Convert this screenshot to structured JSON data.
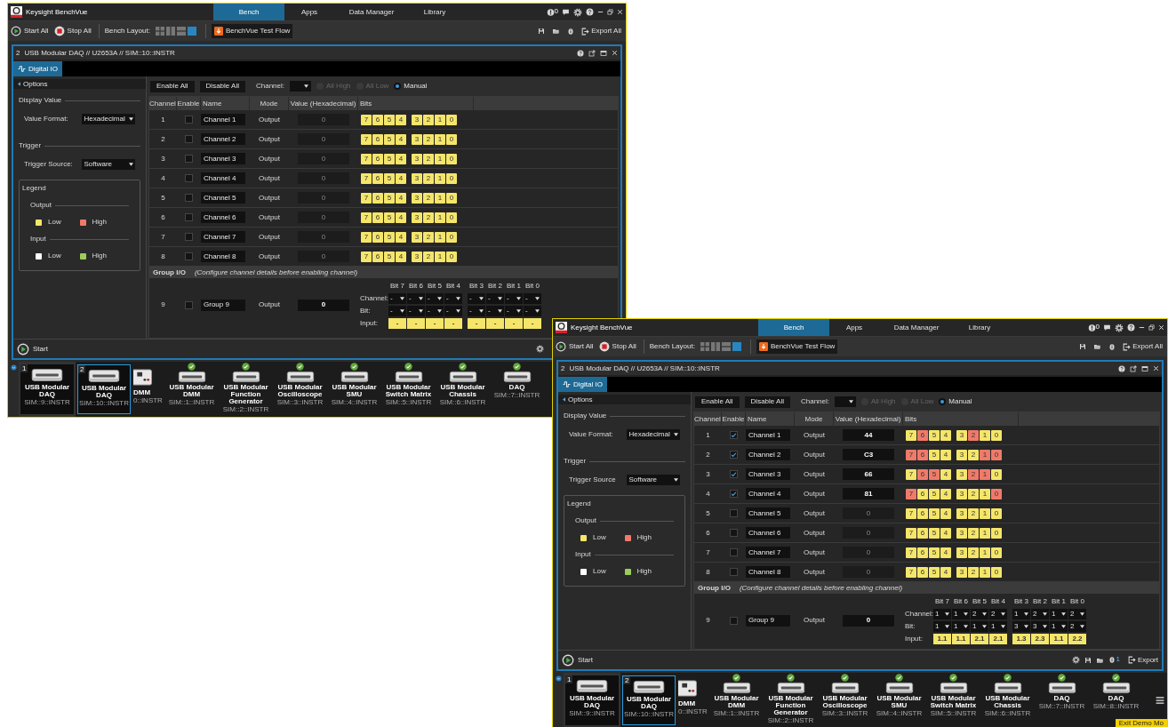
{
  "windows": [
    {
      "app_title": "Keysight BenchVue",
      "nav_tabs": [
        {
          "label": "Bench",
          "selected": true
        },
        {
          "label": "Apps",
          "selected": false
        },
        {
          "label": "Data Manager",
          "selected": false
        },
        {
          "label": "Library",
          "selected": false
        }
      ],
      "notification_count": "0",
      "toolbar": {
        "start_all": "Start All",
        "stop_all": "Stop All",
        "bench_layout_label": "Bench Layout:",
        "layouts": [
          {
            "selected": false
          },
          {
            "selected": false
          },
          {
            "selected": false
          },
          {
            "selected": true
          }
        ],
        "test_flow": "BenchVue Test Flow",
        "export_all": "Export All"
      },
      "instrument": {
        "number": "2",
        "title": "USB Modular DAQ // U2653A // SIM::10::INSTR",
        "tab": "Digital IO",
        "options": {
          "header": "Options",
          "display_value": "Display Value",
          "value_format_label": "Value Format:",
          "value_format": "Hexadecimal",
          "trigger": "Trigger",
          "trigger_source_label": "Trigger Source:",
          "trigger_source": "Software",
          "legend": {
            "title": "Legend",
            "groups": [
              {
                "title": "Output",
                "items": [
                  {
                    "label": "Low",
                    "color": "#f5e66a"
                  },
                  {
                    "label": "High",
                    "color": "#f07a6a"
                  }
                ]
              },
              {
                "title": "Input",
                "items": [
                  {
                    "label": "Low",
                    "color": "#ffffff"
                  },
                  {
                    "label": "High",
                    "color": "#9ccc5a"
                  }
                ]
              }
            ]
          }
        },
        "controls": {
          "enable_all": "Enable All",
          "disable_all": "Disable All",
          "channel_label": "Channel:",
          "modes": [
            {
              "label": "All High",
              "selected": false,
              "disabled": true
            },
            {
              "label": "All Low",
              "selected": false,
              "disabled": true
            },
            {
              "label": "Manual",
              "selected": true,
              "disabled": false
            }
          ]
        },
        "table": {
          "columns": [
            "Channel",
            "Enable",
            "Name",
            "Mode",
            "Value (Hexadecimal)",
            "Bits"
          ],
          "rows": [
            {
              "channel": "1",
              "enabled": false,
              "name": "Channel 1",
              "mode": "Output",
              "value": "0",
              "bits": [
                {
                  "label": "7",
                  "high": false
                },
                {
                  "label": "6",
                  "high": false
                },
                {
                  "label": "5",
                  "high": false
                },
                {
                  "label": "4",
                  "high": false
                },
                {
                  "label": "3",
                  "high": false
                },
                {
                  "label": "2",
                  "high": false
                },
                {
                  "label": "1",
                  "high": false
                },
                {
                  "label": "0",
                  "high": false
                }
              ]
            },
            {
              "channel": "2",
              "enabled": false,
              "name": "Channel 2",
              "mode": "Output",
              "value": "0",
              "bits": [
                {
                  "label": "7",
                  "high": false
                },
                {
                  "label": "6",
                  "high": false
                },
                {
                  "label": "5",
                  "high": false
                },
                {
                  "label": "4",
                  "high": false
                },
                {
                  "label": "3",
                  "high": false
                },
                {
                  "label": "2",
                  "high": false
                },
                {
                  "label": "1",
                  "high": false
                },
                {
                  "label": "0",
                  "high": false
                }
              ]
            },
            {
              "channel": "3",
              "enabled": false,
              "name": "Channel 3",
              "mode": "Output",
              "value": "0",
              "bits": [
                {
                  "label": "7",
                  "high": false
                },
                {
                  "label": "6",
                  "high": false
                },
                {
                  "label": "5",
                  "high": false
                },
                {
                  "label": "4",
                  "high": false
                },
                {
                  "label": "3",
                  "high": false
                },
                {
                  "label": "2",
                  "high": false
                },
                {
                  "label": "1",
                  "high": false
                },
                {
                  "label": "0",
                  "high": false
                }
              ]
            },
            {
              "channel": "4",
              "enabled": false,
              "name": "Channel 4",
              "mode": "Output",
              "value": "0",
              "bits": [
                {
                  "label": "7",
                  "high": false
                },
                {
                  "label": "6",
                  "high": false
                },
                {
                  "label": "5",
                  "high": false
                },
                {
                  "label": "4",
                  "high": false
                },
                {
                  "label": "3",
                  "high": false
                },
                {
                  "label": "2",
                  "high": false
                },
                {
                  "label": "1",
                  "high": false
                },
                {
                  "label": "0",
                  "high": false
                }
              ]
            },
            {
              "channel": "5",
              "enabled": false,
              "name": "Channel 5",
              "mode": "Output",
              "value": "0",
              "bits": [
                {
                  "label": "7",
                  "high": false
                },
                {
                  "label": "6",
                  "high": false
                },
                {
                  "label": "5",
                  "high": false
                },
                {
                  "label": "4",
                  "high": false
                },
                {
                  "label": "3",
                  "high": false
                },
                {
                  "label": "2",
                  "high": false
                },
                {
                  "label": "1",
                  "high": false
                },
                {
                  "label": "0",
                  "high": false
                }
              ]
            },
            {
              "channel": "6",
              "enabled": false,
              "name": "Channel 6",
              "mode": "Output",
              "value": "0",
              "bits": [
                {
                  "label": "7",
                  "high": false
                },
                {
                  "label": "6",
                  "high": false
                },
                {
                  "label": "5",
                  "high": false
                },
                {
                  "label": "4",
                  "high": false
                },
                {
                  "label": "3",
                  "high": false
                },
                {
                  "label": "2",
                  "high": false
                },
                {
                  "label": "1",
                  "high": false
                },
                {
                  "label": "0",
                  "high": false
                }
              ]
            },
            {
              "channel": "7",
              "enabled": false,
              "name": "Channel 7",
              "mode": "Output",
              "value": "0",
              "bits": [
                {
                  "label": "7",
                  "high": false
                },
                {
                  "label": "6",
                  "high": false
                },
                {
                  "label": "5",
                  "high": false
                },
                {
                  "label": "4",
                  "high": false
                },
                {
                  "label": "3",
                  "high": false
                },
                {
                  "label": "2",
                  "high": false
                },
                {
                  "label": "1",
                  "high": false
                },
                {
                  "label": "0",
                  "high": false
                }
              ]
            },
            {
              "channel": "8",
              "enabled": false,
              "name": "Channel 8",
              "mode": "Output",
              "value": "0",
              "bits": [
                {
                  "label": "7",
                  "high": false
                },
                {
                  "label": "6",
                  "high": false
                },
                {
                  "label": "5",
                  "high": false
                },
                {
                  "label": "4",
                  "high": false
                },
                {
                  "label": "3",
                  "high": false
                },
                {
                  "label": "2",
                  "high": false
                },
                {
                  "label": "1",
                  "high": false
                },
                {
                  "label": "0",
                  "high": false
                }
              ]
            }
          ],
          "group_header": "Group I/O",
          "group_note": "(Configure channel details before enabling channel)",
          "group": {
            "channel": "9",
            "enabled": false,
            "name": "Group 9",
            "mode": "Output",
            "value": "0",
            "bit_headers": [
              "Bit 7",
              "Bit 6",
              "Bit 5",
              "Bit 4",
              "Bit 3",
              "Bit 2",
              "Bit 1",
              "Bit 0"
            ],
            "channel_row_label": "Channel:",
            "bit_row_label": "Bit:",
            "input_row_label": "Input:",
            "channel_selects": [
              "-",
              "-",
              "-",
              "-",
              "-",
              "-",
              "-",
              "-"
            ],
            "bit_selects": [
              "-",
              "-",
              "-",
              "-",
              "-",
              "-",
              "-",
              "-"
            ],
            "inputs": [
              "-",
              "-",
              "-",
              "-",
              "-",
              "-",
              "-",
              "-"
            ]
          }
        }
      },
      "bottom_bar": {
        "start": "Start",
        "tools": [
          {
            "kind": "settings"
          }
        ]
      },
      "devices": [
        {
          "kind": "docked",
          "number": "1",
          "name": "USB Modular DAQ",
          "address": "SIM::9::INSTR",
          "selected": false
        },
        {
          "kind": "docked",
          "number": "2",
          "name": "USB Modular DAQ",
          "address": "SIM::10::INSTR",
          "selected": true
        },
        {
          "kind": "cut",
          "name": "DMM",
          "address": "0::INSTR"
        },
        {
          "kind": "available",
          "name": "USB Modular DMM",
          "address": "SIM::1::INSTR"
        },
        {
          "kind": "available",
          "name": "USB Modular Function Generator",
          "address": "SIM::2::INSTR"
        },
        {
          "kind": "available",
          "name": "USB Modular Oscilloscope",
          "address": "SIM::3::INSTR"
        },
        {
          "kind": "available",
          "name": "USB Modular SMU",
          "address": "SIM::4::INSTR"
        },
        {
          "kind": "available",
          "name": "USB Modular Switch Matrix",
          "address": "SIM::5::INSTR"
        },
        {
          "kind": "available",
          "name": "USB Modular Chassis",
          "address": "SIM::6::INSTR"
        },
        {
          "kind": "available",
          "name": "DAQ",
          "address": "SIM::7::INSTR"
        }
      ]
    },
    {
      "app_title": "Keysight BenchVue",
      "nav_tabs": [
        {
          "label": "Bench",
          "selected": true
        },
        {
          "label": "Apps",
          "selected": false
        },
        {
          "label": "Data Manager",
          "selected": false
        },
        {
          "label": "Library",
          "selected": false
        }
      ],
      "notification_count": "0",
      "toolbar": {
        "start_all": "Start All",
        "stop_all": "Stop All",
        "bench_layout_label": "Bench Layout:",
        "layouts": [
          {
            "selected": false
          },
          {
            "selected": false
          },
          {
            "selected": false
          },
          {
            "selected": true
          }
        ],
        "test_flow": "BenchVue Test Flow",
        "export_all": "Export All"
      },
      "instrument": {
        "number": "2",
        "title": "USB Modular DAQ // U2653A // SIM::10::INSTR",
        "tab": "Digital IO",
        "options": {
          "header": "Options",
          "display_value": "Display Value",
          "value_format_label": "Value Format:",
          "value_format": "Hexadecimal",
          "trigger": "Trigger",
          "trigger_source_label": "Trigger Source",
          "trigger_source": "Software",
          "legend": {
            "title": "Legend",
            "groups": [
              {
                "title": "Output",
                "items": [
                  {
                    "label": "Low",
                    "color": "#f5e66a"
                  },
                  {
                    "label": "High",
                    "color": "#f07a6a"
                  }
                ]
              },
              {
                "title": "Input",
                "items": [
                  {
                    "label": "Low",
                    "color": "#ffffff"
                  },
                  {
                    "label": "High",
                    "color": "#9ccc5a"
                  }
                ]
              }
            ]
          }
        },
        "controls": {
          "enable_all": "Enable All",
          "disable_all": "Disable All",
          "channel_label": "Channel:",
          "modes": [
            {
              "label": "All High",
              "selected": false,
              "disabled": true
            },
            {
              "label": "All Low",
              "selected": false,
              "disabled": true
            },
            {
              "label": "Manual",
              "selected": true,
              "disabled": false
            }
          ]
        },
        "table": {
          "columns": [
            "Channel",
            "Enable",
            "Name",
            "Mode",
            "Value (Hexadecimal)",
            "Bits"
          ],
          "rows": [
            {
              "channel": "1",
              "enabled": true,
              "name": "Channel 1",
              "mode": "Output",
              "value": "44",
              "bits": [
                {
                  "label": "7",
                  "high": false
                },
                {
                  "label": "6",
                  "high": true
                },
                {
                  "label": "5",
                  "high": false
                },
                {
                  "label": "4",
                  "high": false
                },
                {
                  "label": "3",
                  "high": false
                },
                {
                  "label": "2",
                  "high": true
                },
                {
                  "label": "1",
                  "high": false
                },
                {
                  "label": "0",
                  "high": false
                }
              ]
            },
            {
              "channel": "2",
              "enabled": true,
              "name": "Channel 2",
              "mode": "Output",
              "value": "C3",
              "bits": [
                {
                  "label": "7",
                  "high": true
                },
                {
                  "label": "6",
                  "high": true
                },
                {
                  "label": "5",
                  "high": false
                },
                {
                  "label": "4",
                  "high": false
                },
                {
                  "label": "3",
                  "high": false
                },
                {
                  "label": "2",
                  "high": false
                },
                {
                  "label": "1",
                  "high": true
                },
                {
                  "label": "0",
                  "high": true
                }
              ]
            },
            {
              "channel": "3",
              "enabled": true,
              "name": "Channel 3",
              "mode": "Output",
              "value": "66",
              "bits": [
                {
                  "label": "7",
                  "high": false
                },
                {
                  "label": "6",
                  "high": true
                },
                {
                  "label": "5",
                  "high": true
                },
                {
                  "label": "4",
                  "high": false
                },
                {
                  "label": "3",
                  "high": false
                },
                {
                  "label": "2",
                  "high": true
                },
                {
                  "label": "1",
                  "high": true
                },
                {
                  "label": "0",
                  "high": false
                }
              ]
            },
            {
              "channel": "4",
              "enabled": true,
              "name": "Channel 4",
              "mode": "Output",
              "value": "81",
              "bits": [
                {
                  "label": "7",
                  "high": true
                },
                {
                  "label": "6",
                  "high": false
                },
                {
                  "label": "5",
                  "high": false
                },
                {
                  "label": "4",
                  "high": false
                },
                {
                  "label": "3",
                  "high": false
                },
                {
                  "label": "2",
                  "high": false
                },
                {
                  "label": "1",
                  "high": false
                },
                {
                  "label": "0",
                  "high": true
                }
              ]
            },
            {
              "channel": "5",
              "enabled": false,
              "name": "Channel 5",
              "mode": "Output",
              "value": "0",
              "bits": [
                {
                  "label": "7",
                  "high": false
                },
                {
                  "label": "6",
                  "high": false
                },
                {
                  "label": "5",
                  "high": false
                },
                {
                  "label": "4",
                  "high": false
                },
                {
                  "label": "3",
                  "high": false
                },
                {
                  "label": "2",
                  "high": false
                },
                {
                  "label": "1",
                  "high": false
                },
                {
                  "label": "0",
                  "high": false
                }
              ]
            },
            {
              "channel": "6",
              "enabled": false,
              "name": "Channel 6",
              "mode": "Output",
              "value": "0",
              "bits": [
                {
                  "label": "7",
                  "high": false
                },
                {
                  "label": "6",
                  "high": false
                },
                {
                  "label": "5",
                  "high": false
                },
                {
                  "label": "4",
                  "high": false
                },
                {
                  "label": "3",
                  "high": false
                },
                {
                  "label": "2",
                  "high": false
                },
                {
                  "label": "1",
                  "high": false
                },
                {
                  "label": "0",
                  "high": false
                }
              ]
            },
            {
              "channel": "7",
              "enabled": false,
              "name": "Channel 7",
              "mode": "Output",
              "value": "0",
              "bits": [
                {
                  "label": "7",
                  "high": false
                },
                {
                  "label": "6",
                  "high": false
                },
                {
                  "label": "5",
                  "high": false
                },
                {
                  "label": "4",
                  "high": false
                },
                {
                  "label": "3",
                  "high": false
                },
                {
                  "label": "2",
                  "high": false
                },
                {
                  "label": "1",
                  "high": false
                },
                {
                  "label": "0",
                  "high": false
                }
              ]
            },
            {
              "channel": "8",
              "enabled": false,
              "name": "Channel 8",
              "mode": "Output",
              "value": "0",
              "bits": [
                {
                  "label": "7",
                  "high": false
                },
                {
                  "label": "6",
                  "high": false
                },
                {
                  "label": "5",
                  "high": false
                },
                {
                  "label": "4",
                  "high": false
                },
                {
                  "label": "3",
                  "high": false
                },
                {
                  "label": "2",
                  "high": false
                },
                {
                  "label": "1",
                  "high": false
                },
                {
                  "label": "0",
                  "high": false
                }
              ]
            }
          ],
          "group_header": "Group I/O",
          "group_note": "(Configure channel details before enabling channel)",
          "group": {
            "channel": "9",
            "enabled": false,
            "name": "Group 9",
            "mode": "Output",
            "value": "0",
            "bit_headers": [
              "Bit 7",
              "Bit 6",
              "Bit 5",
              "Bit 4",
              "Bit 3",
              "Bit 2",
              "Bit 1",
              "Bit 0"
            ],
            "channel_row_label": "Channel:",
            "bit_row_label": "Bit:",
            "input_row_label": "Input:",
            "channel_selects": [
              "1",
              "1",
              "2",
              "2",
              "1",
              "2",
              "1",
              "2"
            ],
            "bit_selects": [
              "1",
              "1",
              "1",
              "1",
              "3",
              "3",
              "1",
              "2"
            ],
            "inputs": [
              "1.1",
              "1.1",
              "2.1",
              "2.1",
              "1.3",
              "2.3",
              "1.1",
              "2.2"
            ]
          }
        }
      },
      "bottom_bar": {
        "start": "Start",
        "tools": [
          {
            "kind": "settings"
          },
          {
            "kind": "save"
          },
          {
            "kind": "open"
          },
          {
            "kind": "info",
            "count": "1"
          }
        ],
        "export": "Export"
      },
      "devices": [
        {
          "kind": "docked",
          "number": "1",
          "name": "USB Modular DAQ",
          "address": "SIM::9::INSTR",
          "selected": false
        },
        {
          "kind": "docked",
          "number": "2",
          "name": "USB Modular DAQ",
          "address": "SIM::10::INSTR",
          "selected": true
        },
        {
          "kind": "cut",
          "name": "DMM",
          "address": "0::INSTR"
        },
        {
          "kind": "available",
          "name": "USB Modular DMM",
          "address": "SIM::1::INSTR"
        },
        {
          "kind": "available",
          "name": "USB Modular Function Generator",
          "address": "SIM::2::INSTR"
        },
        {
          "kind": "available",
          "name": "USB Modular Oscilloscope",
          "address": "SIM::3::INSTR"
        },
        {
          "kind": "available",
          "name": "USB Modular SMU",
          "address": "SIM::4::INSTR"
        },
        {
          "kind": "available",
          "name": "USB Modular Switch Matrix",
          "address": "SIM::5::INSTR"
        },
        {
          "kind": "available",
          "name": "USB Modular Chassis",
          "address": "SIM::6::INSTR"
        },
        {
          "kind": "available",
          "name": "DAQ",
          "address": "SIM::7::INSTR"
        },
        {
          "kind": "available",
          "name": "DAQ",
          "address": "SIM::8::INSTR"
        }
      ],
      "device_menu": true,
      "demo_badge": "Exit Demo Mo"
    }
  ]
}
